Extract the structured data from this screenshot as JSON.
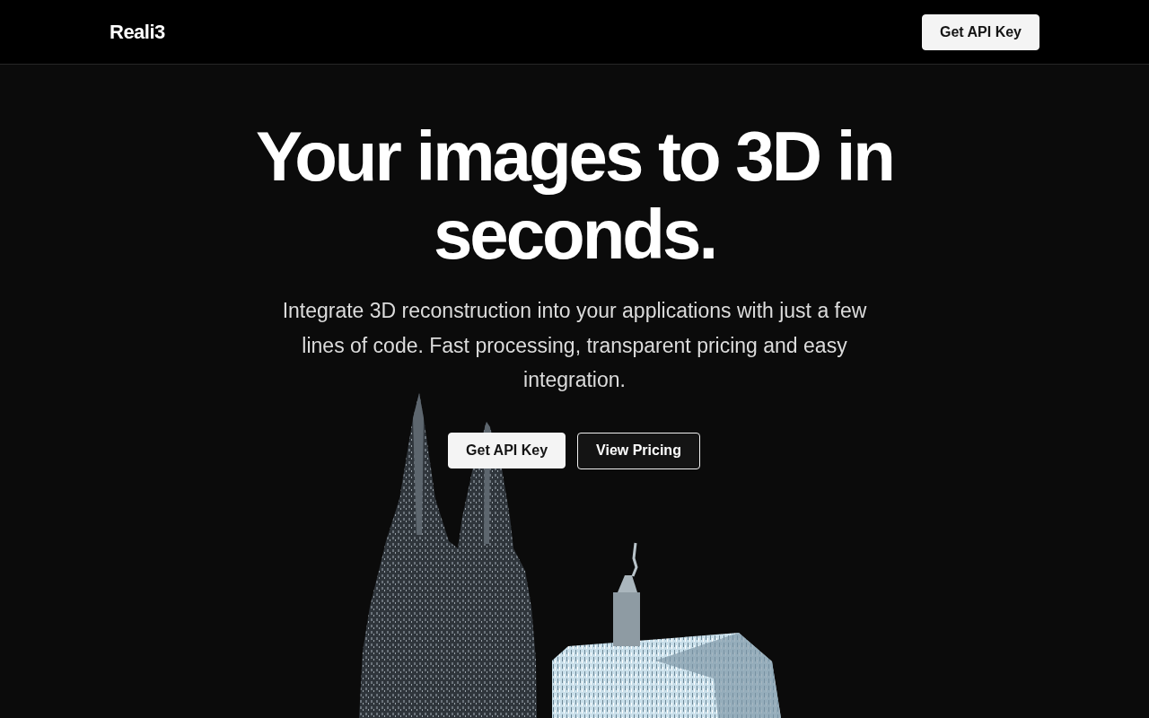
{
  "header": {
    "logo": "Reali3",
    "button": "Get API Key"
  },
  "hero": {
    "title": "Your images to 3D in seconds.",
    "description": "Integrate 3D reconstruction into your applications with just a few lines of code. Fast processing, transparent pricing and easy integration.",
    "buttons": [
      {
        "label": "Get API Key",
        "kind": "primary"
      },
      {
        "label": "View Pricing",
        "kind": "secondary"
      }
    ]
  }
}
